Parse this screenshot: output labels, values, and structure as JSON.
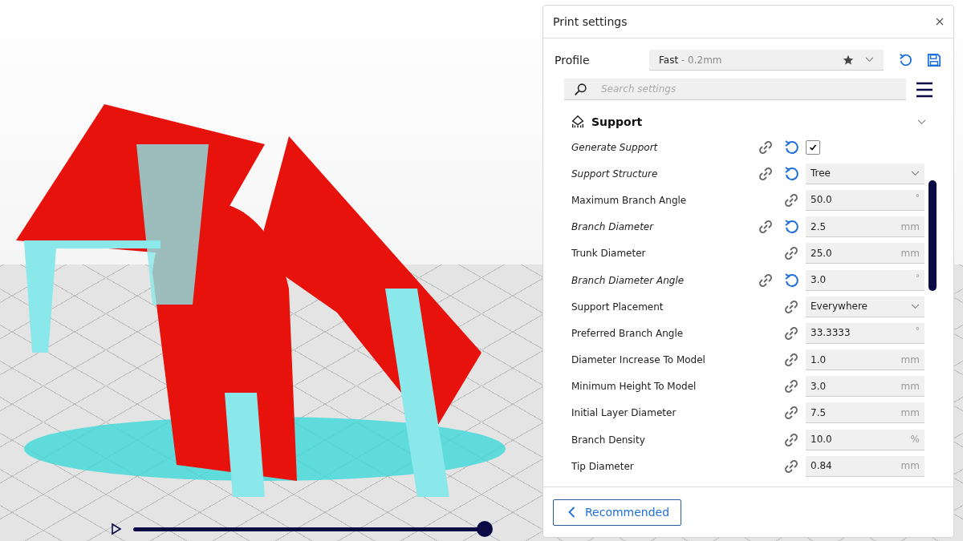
{
  "viewport": {
    "slider": {
      "level": 1.0
    }
  },
  "panel": {
    "title": "Print settings",
    "profile": {
      "label": "Profile",
      "name": "Fast",
      "detail": " - 0.2mm"
    },
    "search": {
      "placeholder": "Search settings"
    },
    "category": {
      "title": "Support",
      "expanded": true
    },
    "settings": [
      {
        "kind": "checkbox",
        "label": "Generate Support",
        "overridden": true,
        "checked": true
      },
      {
        "kind": "dropdown",
        "label": "Support Structure",
        "overridden": true,
        "value": "Tree"
      },
      {
        "kind": "number",
        "label": "Maximum Branch Angle",
        "overridden": false,
        "value": "50.0",
        "unit": "°"
      },
      {
        "kind": "number",
        "label": "Branch Diameter",
        "overridden": true,
        "value": "2.5",
        "unit": "mm"
      },
      {
        "kind": "number",
        "label": "Trunk Diameter",
        "overridden": false,
        "value": "25.0",
        "unit": "mm"
      },
      {
        "kind": "number",
        "label": "Branch Diameter Angle",
        "overridden": true,
        "value": "3.0",
        "unit": "°"
      },
      {
        "kind": "dropdown",
        "label": "Support Placement",
        "overridden": false,
        "value": "Everywhere"
      },
      {
        "kind": "number",
        "label": "Preferred Branch Angle",
        "overridden": false,
        "value": "33.3333",
        "unit": "°"
      },
      {
        "kind": "number",
        "label": "Diameter Increase To Model",
        "overridden": false,
        "value": "1.0",
        "unit": "mm"
      },
      {
        "kind": "number",
        "label": "Minimum Height To Model",
        "overridden": false,
        "value": "3.0",
        "unit": "mm"
      },
      {
        "kind": "number",
        "label": "Initial Layer Diameter",
        "overridden": false,
        "value": "7.5",
        "unit": "mm"
      },
      {
        "kind": "number",
        "label": "Branch Density",
        "overridden": false,
        "value": "10.0",
        "unit": "%"
      },
      {
        "kind": "number",
        "label": "Tip Diameter",
        "overridden": false,
        "value": "0.84",
        "unit": "mm"
      }
    ],
    "footer_button": "Recommended"
  }
}
